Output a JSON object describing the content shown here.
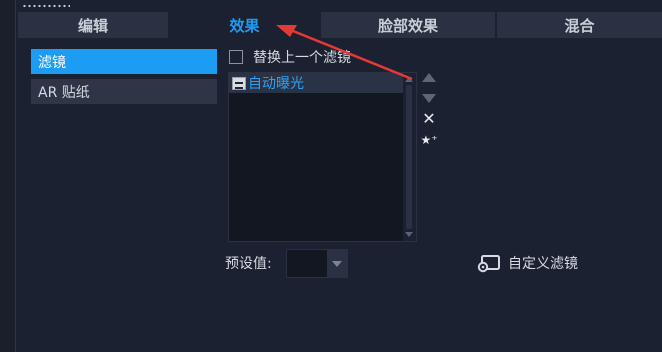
{
  "tabs": [
    {
      "label": "编辑",
      "active": false
    },
    {
      "label": "效果",
      "active": true
    },
    {
      "label": "脸部效果",
      "active": false
    },
    {
      "label": "混合",
      "active": false
    }
  ],
  "categories": [
    {
      "label": "滤镜",
      "selected": true
    },
    {
      "label": "AR 贴纸",
      "selected": false
    }
  ],
  "replace_filter": {
    "label": "替换上一个滤镜",
    "checked": false
  },
  "filter_list": {
    "items": [
      {
        "label": "自动曝光",
        "icon": "filter-icon"
      }
    ]
  },
  "tools": [
    "move-up-icon",
    "move-down-icon",
    "remove-icon",
    "add-to-favorites-icon"
  ],
  "preset": {
    "label": "预设值:",
    "value": ""
  },
  "custom_filter": {
    "label": "自定义滤镜",
    "icon": "custom-filter-icon"
  },
  "colors": {
    "accent": "#1f9bf0",
    "annotation_arrow": "#e53935",
    "background": "#1b2130"
  }
}
